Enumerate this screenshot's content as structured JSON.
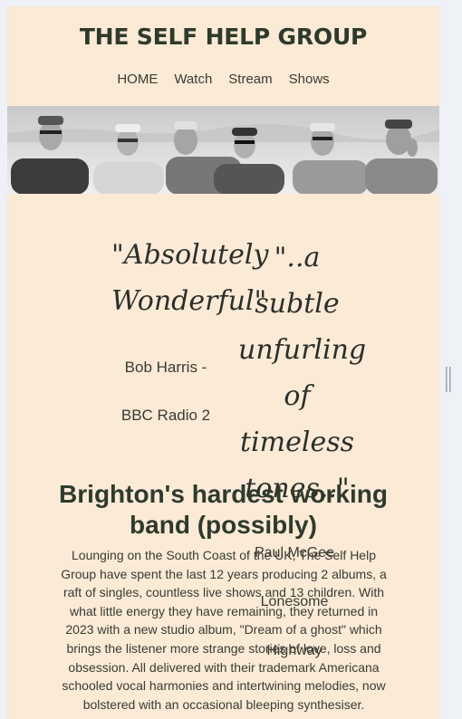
{
  "header": {
    "title": "THE SELF HELP GROUP",
    "nav": [
      "HOME",
      "Watch",
      "Stream",
      "Shows"
    ]
  },
  "quotes": [
    {
      "text": "\"Absolutely Wonderful\"",
      "attribution": "Bob Harris - BBC Radio 2"
    },
    {
      "text": "\"..a subtle unfurling of timeless tones..\"",
      "attribution": "Paul McGee Lonesome Highway"
    }
  ],
  "main": {
    "heading": "Brighton's hardest working band (possibly)",
    "body": "Lounging on the South Coast of the UK, The Self Help Group have spent the last 12 years producing 2 albums, a raft of singles, countless live shows and 13 children. With what little energy they have remaining, they returned in 2023 with a new studio album, \"Dream of a ghost\" which brings the listener more strange stories of love, loss and obsession. All delivered with their trademark Americana schooled vocal harmonies and intertwining melodies, now bolstered with an occasional bleeping synthesiser."
  },
  "colors": {
    "page_bg": "#faead6",
    "outer_bg": "#eef1f5",
    "heading": "#2f3a2c"
  }
}
